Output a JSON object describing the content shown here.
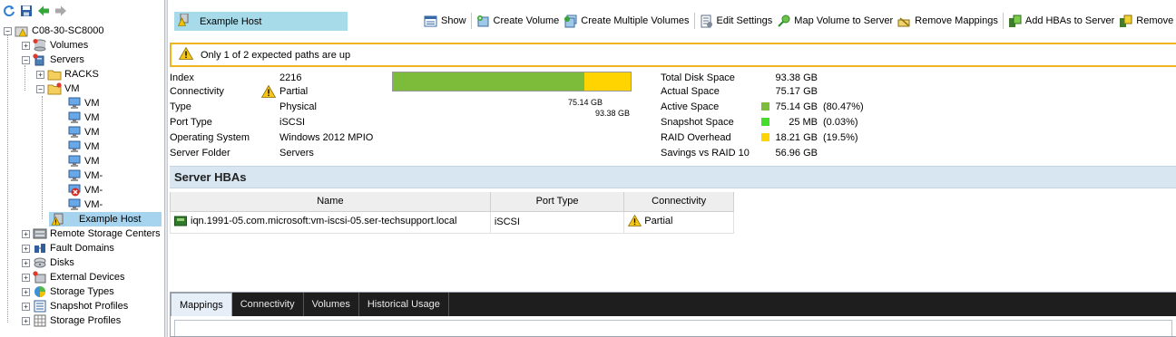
{
  "tree": {
    "root": "C08-30-SC8000",
    "volumes": "Volumes",
    "servers": "Servers",
    "racks": "RACKS",
    "vm_folder": "VM",
    "vm_items": [
      "VM",
      "VM",
      "VM",
      "VM",
      "VM",
      "VM-",
      "VM-",
      "VM-"
    ],
    "selected": "Example Host",
    "remote_storage_centers": "Remote Storage Centers",
    "fault_domains": "Fault Domains",
    "disks": "Disks",
    "external_devices": "External Devices",
    "storage_types": "Storage Types",
    "snapshot_profiles": "Snapshot Profiles",
    "storage_profiles": "Storage Profiles"
  },
  "header": {
    "title": "Example Host"
  },
  "actions": {
    "show": "Show",
    "create_volume": "Create Volume",
    "create_multiple_volumes": "Create Multiple Volumes",
    "edit_settings": "Edit Settings",
    "map_volume": "Map Volume to Server",
    "remove_mappings": "Remove Mappings",
    "add_hbas": "Add HBAs to Server",
    "remove_hbas": "Remove HBAs fro"
  },
  "warning": {
    "message": "Only 1 of 2 expected paths are up"
  },
  "properties": {
    "index_label": "Index",
    "index_value": "2216",
    "connectivity_label": "Connectivity",
    "connectivity_value": "Partial",
    "type_label": "Type",
    "type_value": "Physical",
    "port_type_label": "Port Type",
    "port_type_value": "iSCSI",
    "os_label": "Operating System",
    "os_value": "Windows 2012 MPIO",
    "folder_label": "Server Folder",
    "folder_value": "Servers"
  },
  "usage_bar": {
    "active_fraction": 0.8047,
    "raid_fraction": 0.195,
    "active_label": "75.14 GB",
    "total_label": "93.38 GB"
  },
  "space": {
    "total_label": "Total Disk Space",
    "total_value": "93.38 GB",
    "actual_label": "Actual Space",
    "actual_value": "75.17 GB",
    "active_label": "Active Space",
    "active_value": "75.14 GB",
    "active_pct": "(80.47%)",
    "snapshot_label": "Snapshot Space",
    "snapshot_value": "25 MB",
    "snapshot_pct": "(0.03%)",
    "raid_label": "RAID Overhead",
    "raid_value": "18.21 GB",
    "raid_pct": "(19.5%)",
    "savings_label": "Savings vs RAID 10",
    "savings_value": "56.96 GB"
  },
  "colors": {
    "active": "#7dbb3a",
    "snapshot": "#44dd2a",
    "raid": "#ffd400",
    "warning_border": "#f0b41e"
  },
  "hba": {
    "title": "Server HBAs",
    "columns": [
      "Name",
      "Port Type",
      "Connectivity"
    ],
    "rows": [
      {
        "name": "iqn.1991-05.com.microsoft:vm-iscsi-05.ser-techsupport.local",
        "port_type": "iSCSI",
        "connectivity": "Partial"
      }
    ]
  },
  "tabs": [
    "Mappings",
    "Connectivity",
    "Volumes",
    "Historical Usage"
  ]
}
